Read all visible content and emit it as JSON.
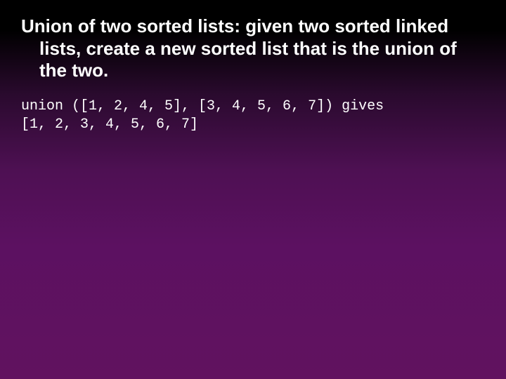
{
  "slide": {
    "heading": "Union of two sorted lists: given two sorted linked lists, create a new sorted list that is the union of the two.",
    "code_line1": "union ([1, 2, 4, 5], [3, 4, 5, 6, 7]) gives",
    "code_line2": "[1, 2, 3, 4, 5, 6, 7]"
  }
}
